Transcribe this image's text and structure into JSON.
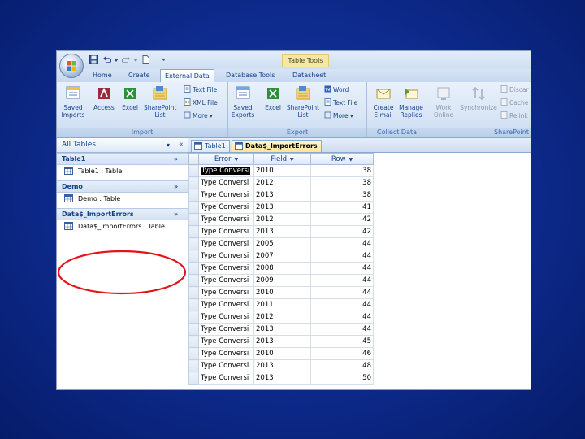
{
  "titlebar": {
    "contextual_group": "Table Tools",
    "qat_icons": [
      "save-icon",
      "undo-icon",
      "redo-icon",
      "new-document-icon",
      "customize-dropdown-icon"
    ]
  },
  "tabs": [
    "Home",
    "Create",
    "External Data",
    "Database Tools",
    "Datasheet"
  ],
  "active_tab": "External Data",
  "ribbon": {
    "import": {
      "label": "Import",
      "saved_imports": "Saved\nImports",
      "access": "Access",
      "excel": "Excel",
      "sharepoint_list": "SharePoint\nList",
      "text_file": "Text File",
      "xml_file": "XML File",
      "more": "More ▾"
    },
    "export": {
      "label": "Export",
      "saved_exports": "Saved\nExports",
      "excel": "Excel",
      "sharepoint_list": "SharePoint\nList",
      "word": "Word",
      "text_file": "Text File",
      "more": "More ▾"
    },
    "collect": {
      "label": "Collect Data",
      "create_email": "Create\nE-mail",
      "manage_replies": "Manage\nReplies"
    },
    "sharepoint": {
      "label": "SharePoint",
      "work_online": "Work\nOnline",
      "synchronize": "Synchronize",
      "discard": "Discar",
      "cache": "Cache",
      "relink": "Relink"
    }
  },
  "nav": {
    "header": "All Tables",
    "dropdown": "▾",
    "collapse": "«",
    "groups": [
      {
        "name": "Table1",
        "chevron": "»",
        "items": [
          "Table1 : Table"
        ]
      },
      {
        "name": "Demo",
        "chevron": "»",
        "items": [
          "Demo : Table"
        ]
      },
      {
        "name": "Data$_ImportErrors",
        "chevron": "»",
        "items": [
          "Data$_ImportErrors : Table"
        ]
      }
    ]
  },
  "doc_tabs": [
    "Table1",
    "Data$_ImportErrors"
  ],
  "active_doc_tab": "Data$_ImportErrors",
  "grid": {
    "columns": [
      "Error",
      "Field",
      "Row"
    ],
    "rows": [
      [
        "Type Conversi",
        "2010",
        "38"
      ],
      [
        "Type Conversi",
        "2012",
        "38"
      ],
      [
        "Type Conversi",
        "2013",
        "38"
      ],
      [
        "Type Conversi",
        "2013",
        "41"
      ],
      [
        "Type Conversi",
        "2012",
        "42"
      ],
      [
        "Type Conversi",
        "2013",
        "42"
      ],
      [
        "Type Conversi",
        "2005",
        "44"
      ],
      [
        "Type Conversi",
        "2007",
        "44"
      ],
      [
        "Type Conversi",
        "2008",
        "44"
      ],
      [
        "Type Conversi",
        "2009",
        "44"
      ],
      [
        "Type Conversi",
        "2010",
        "44"
      ],
      [
        "Type Conversi",
        "2011",
        "44"
      ],
      [
        "Type Conversi",
        "2012",
        "44"
      ],
      [
        "Type Conversi",
        "2013",
        "44"
      ],
      [
        "Type Conversi",
        "2013",
        "45"
      ],
      [
        "Type Conversi",
        "2010",
        "46"
      ],
      [
        "Type Conversi",
        "2013",
        "48"
      ],
      [
        "Type Conversi",
        "2013",
        "50"
      ]
    ]
  },
  "annotation_color": "#e0151b"
}
